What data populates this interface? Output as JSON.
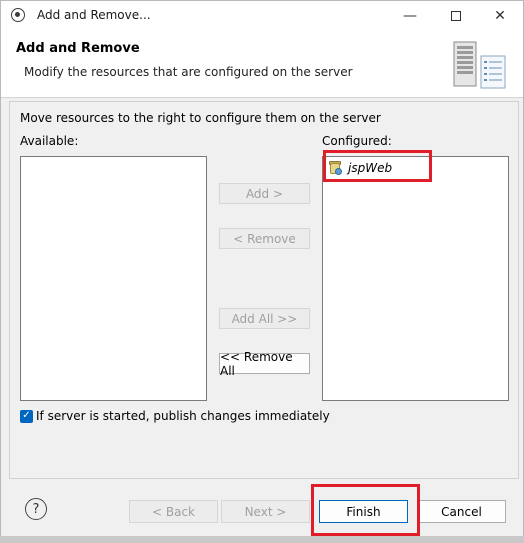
{
  "window": {
    "title": "Add and Remove..."
  },
  "header": {
    "title": "Add and Remove",
    "description": "Modify the resources that are configured on the server"
  },
  "main": {
    "instruction": "Move resources to the right to configure them on the server",
    "available_label": "Available:",
    "configured_label": "Configured:",
    "available_items": [],
    "configured_items": [
      {
        "label": "jspWeb",
        "icon": "web-project-icon"
      }
    ],
    "buttons": {
      "add": "Add >",
      "remove": "< Remove",
      "add_all": "Add All >>",
      "remove_all": "<< Remove All"
    },
    "publish_checkbox": {
      "label": "If server is started, publish changes immediately",
      "checked": true
    }
  },
  "footer": {
    "help_icon": "help-icon",
    "back": "< Back",
    "next": "Next >",
    "finish": "Finish",
    "cancel": "Cancel"
  },
  "colors": {
    "accent": "#0067c0",
    "highlight": "#e01e2a"
  }
}
